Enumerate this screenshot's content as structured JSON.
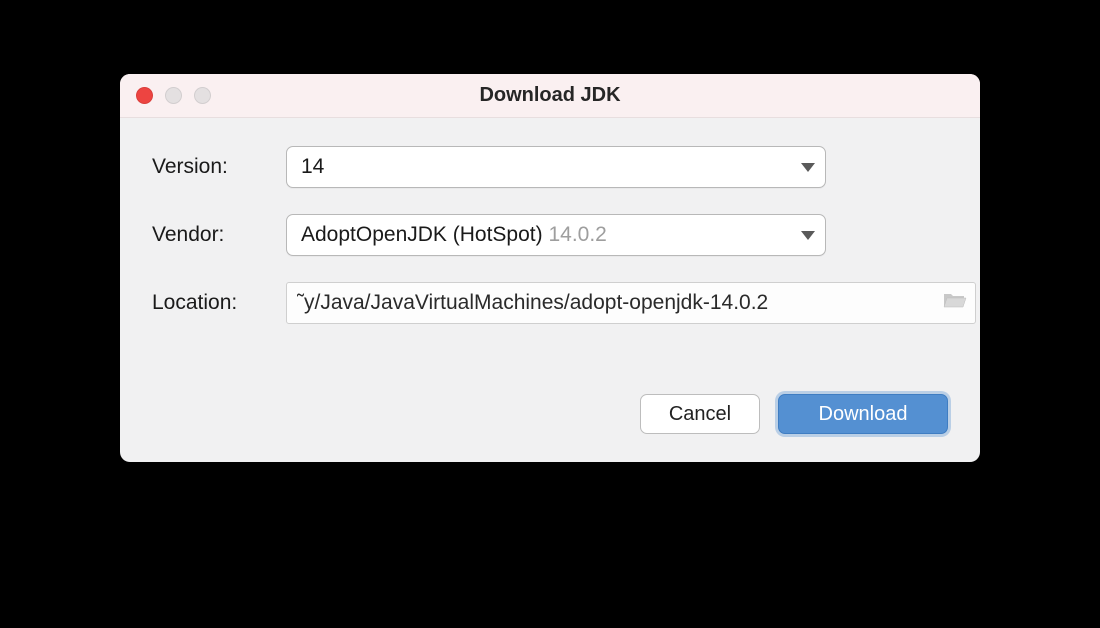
{
  "window": {
    "title": "Download JDK"
  },
  "fields": {
    "version": {
      "label": "Version:",
      "value": "14"
    },
    "vendor": {
      "label": "Vendor:",
      "value": "AdoptOpenJDK (HotSpot) ",
      "detail": "14.0.2"
    },
    "location": {
      "label": "Location:",
      "value": "˜y/Java/JavaVirtualMachines/adopt-openjdk-14.0.2"
    }
  },
  "buttons": {
    "cancel": "Cancel",
    "download": "Download"
  }
}
